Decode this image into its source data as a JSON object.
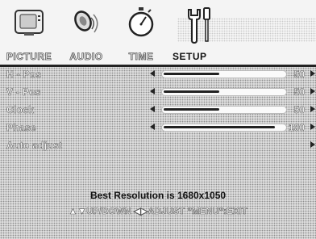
{
  "tabs": [
    {
      "label": "PICTURE",
      "icon": "tv-icon",
      "active": false
    },
    {
      "label": "AUDIO",
      "icon": "speaker-icon",
      "active": false
    },
    {
      "label": "TIME",
      "icon": "stopwatch-icon",
      "active": false
    },
    {
      "label": "SETUP",
      "icon": "wrench-screwdriver-icon",
      "active": true
    }
  ],
  "settings": [
    {
      "label": "H - Pos",
      "value": "50",
      "level": 0.5
    },
    {
      "label": "V - Pos",
      "value": "50",
      "level": 0.5
    },
    {
      "label": "Clock",
      "value": "50",
      "level": 0.5
    },
    {
      "label": "Phase",
      "value": "100",
      "level": 1.0
    },
    {
      "label": "Auto adjust"
    }
  ],
  "footer": {
    "resolution": "Best Resolution is 1680x1050",
    "hint": "▲▼UP/DOWN  ◀▶ADJUST  \"MENU\":EXIT"
  },
  "colors": {
    "accent": "#222222",
    "panel": "#dcdcdc"
  }
}
